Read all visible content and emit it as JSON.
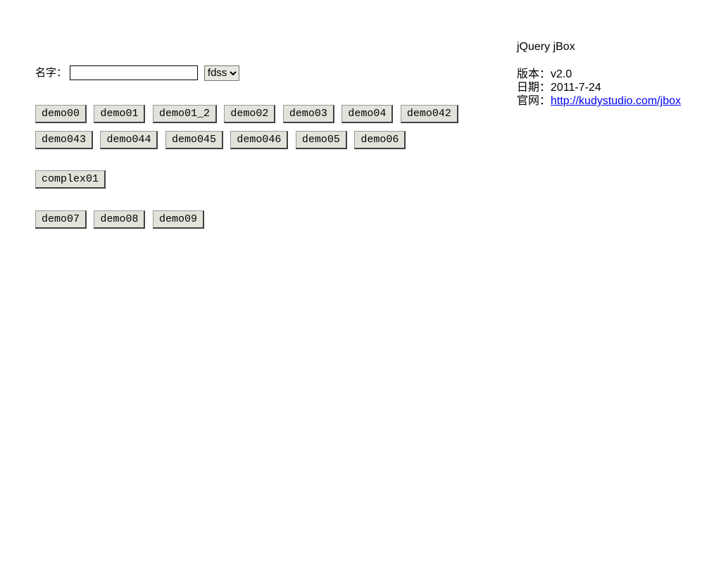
{
  "sidebar": {
    "title": "jQuery jBox",
    "version_label": "版本：",
    "version_value": "v2.0",
    "date_label": "日期：",
    "date_value": "2011-7-24",
    "site_label": "官网：",
    "site_link_text": "http://kudystudio.com/jbox"
  },
  "form": {
    "name_label": "名字：",
    "name_value": "",
    "select_value": "fdss"
  },
  "buttons_row1": [
    "demo00",
    "demo01",
    "demo01_2",
    "demo02",
    "demo03",
    "demo04",
    "demo042",
    "demo043",
    "demo044",
    "demo045",
    "demo046",
    "demo05",
    "demo06"
  ],
  "buttons_row2": [
    "complex01"
  ],
  "buttons_row3": [
    "demo07",
    "demo08",
    "demo09"
  ]
}
